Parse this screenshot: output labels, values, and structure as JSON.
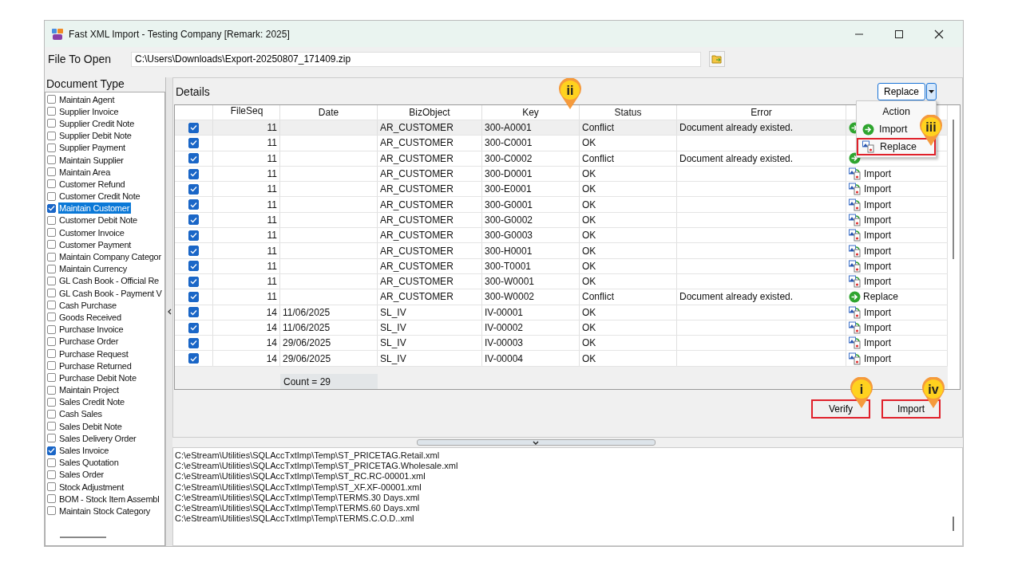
{
  "window": {
    "title": "Fast XML Import - Testing Company [Remark: 2025]"
  },
  "file_to_open": {
    "label": "File To Open",
    "value": "C:\\Users\\Downloads\\Export-20250807_171409.zip"
  },
  "document_type": {
    "title": "Document Type",
    "items": [
      {
        "label": "Maintain Agent",
        "checked": false,
        "selected": false
      },
      {
        "label": "Supplier Invoice",
        "checked": false,
        "selected": false
      },
      {
        "label": "Supplier Credit Note",
        "checked": false,
        "selected": false
      },
      {
        "label": "Supplier Debit Note",
        "checked": false,
        "selected": false
      },
      {
        "label": "Supplier Payment",
        "checked": false,
        "selected": false
      },
      {
        "label": "Maintain Supplier",
        "checked": false,
        "selected": false
      },
      {
        "label": "Maintain Area",
        "checked": false,
        "selected": false
      },
      {
        "label": "Customer Refund",
        "checked": false,
        "selected": false
      },
      {
        "label": "Customer Credit Note",
        "checked": false,
        "selected": false
      },
      {
        "label": "Maintain Customer",
        "checked": true,
        "selected": true
      },
      {
        "label": "Customer Debit Note",
        "checked": false,
        "selected": false
      },
      {
        "label": "Customer Invoice",
        "checked": false,
        "selected": false
      },
      {
        "label": "Customer Payment",
        "checked": false,
        "selected": false
      },
      {
        "label": "Maintain Company Categor",
        "checked": false,
        "selected": false
      },
      {
        "label": "Maintain Currency",
        "checked": false,
        "selected": false
      },
      {
        "label": "GL Cash Book - Official Re",
        "checked": false,
        "selected": false
      },
      {
        "label": "GL Cash Book - Payment V",
        "checked": false,
        "selected": false
      },
      {
        "label": "Cash Purchase",
        "checked": false,
        "selected": false
      },
      {
        "label": "Goods Received",
        "checked": false,
        "selected": false
      },
      {
        "label": "Purchase Invoice",
        "checked": false,
        "selected": false
      },
      {
        "label": "Purchase Order",
        "checked": false,
        "selected": false
      },
      {
        "label": "Purchase Request",
        "checked": false,
        "selected": false
      },
      {
        "label": "Purchase Returned",
        "checked": false,
        "selected": false
      },
      {
        "label": "Purchase Debit Note",
        "checked": false,
        "selected": false
      },
      {
        "label": "Maintain Project",
        "checked": false,
        "selected": false
      },
      {
        "label": "Sales Credit Note",
        "checked": false,
        "selected": false
      },
      {
        "label": "Cash Sales",
        "checked": false,
        "selected": false
      },
      {
        "label": "Sales Debit Note",
        "checked": false,
        "selected": false
      },
      {
        "label": "Sales Delivery Order",
        "checked": false,
        "selected": false
      },
      {
        "label": "Sales Invoice",
        "checked": true,
        "selected": false
      },
      {
        "label": "Sales Quotation",
        "checked": false,
        "selected": false
      },
      {
        "label": "Sales Order",
        "checked": false,
        "selected": false
      },
      {
        "label": "Stock Adjustment",
        "checked": false,
        "selected": false
      },
      {
        "label": "BOM - Stock Item Assembl",
        "checked": false,
        "selected": false
      },
      {
        "label": "Maintain Stock Category",
        "checked": false,
        "selected": false
      }
    ]
  },
  "details": {
    "title": "Details",
    "action_button": {
      "label": "Replace"
    },
    "menu": {
      "header": "Action",
      "items": [
        {
          "label": "Import",
          "kind": "arrow",
          "highlighted": false
        },
        {
          "label": "Replace",
          "kind": "image",
          "highlighted": true
        }
      ]
    },
    "table": {
      "columns": [
        "FileSeq",
        "Date",
        "BizObject",
        "Key",
        "Status",
        "Error"
      ],
      "rows": [
        {
          "selected": true,
          "checked": true,
          "fileseq": "11",
          "bizobject": "AR_CUSTOMER",
          "key": "300-A0001",
          "status": "Conflict",
          "error": "Document already existed.",
          "action": {
            "kind": "arrow"
          }
        },
        {
          "selected": false,
          "checked": true,
          "fileseq": "11",
          "bizobject": "AR_CUSTOMER",
          "key": "300-C0001",
          "status": "OK"
        },
        {
          "selected": false,
          "checked": true,
          "fileseq": "11",
          "bizobject": "AR_CUSTOMER",
          "key": "300-C0002",
          "status": "Conflict",
          "error": "Document already existed.",
          "action": {
            "kind": "arrow"
          }
        },
        {
          "selected": false,
          "checked": true,
          "fileseq": "11",
          "bizobject": "AR_CUSTOMER",
          "key": "300-D0001",
          "status": "OK",
          "action": {
            "kind": "image",
            "label": "Import"
          }
        },
        {
          "selected": false,
          "checked": true,
          "fileseq": "11",
          "bizobject": "AR_CUSTOMER",
          "key": "300-E0001",
          "status": "OK",
          "action": {
            "kind": "image",
            "label": "Import"
          }
        },
        {
          "selected": false,
          "checked": true,
          "fileseq": "11",
          "bizobject": "AR_CUSTOMER",
          "key": "300-G0001",
          "status": "OK",
          "action": {
            "kind": "image",
            "label": "Import"
          }
        },
        {
          "selected": false,
          "checked": true,
          "fileseq": "11",
          "bizobject": "AR_CUSTOMER",
          "key": "300-G0002",
          "status": "OK",
          "action": {
            "kind": "image",
            "label": "Import"
          }
        },
        {
          "selected": false,
          "checked": true,
          "fileseq": "11",
          "bizobject": "AR_CUSTOMER",
          "key": "300-G0003",
          "status": "OK",
          "action": {
            "kind": "image",
            "label": "Import"
          }
        },
        {
          "selected": false,
          "checked": true,
          "fileseq": "11",
          "bizobject": "AR_CUSTOMER",
          "key": "300-H0001",
          "status": "OK",
          "action": {
            "kind": "image",
            "label": "Import"
          }
        },
        {
          "selected": false,
          "checked": true,
          "fileseq": "11",
          "bizobject": "AR_CUSTOMER",
          "key": "300-T0001",
          "status": "OK",
          "action": {
            "kind": "image",
            "label": "Import"
          }
        },
        {
          "selected": false,
          "checked": true,
          "fileseq": "11",
          "bizobject": "AR_CUSTOMER",
          "key": "300-W0001",
          "status": "OK",
          "action": {
            "kind": "image",
            "label": "Import"
          }
        },
        {
          "selected": false,
          "checked": true,
          "fileseq": "11",
          "bizobject": "AR_CUSTOMER",
          "key": "300-W0002",
          "status": "Conflict",
          "error": "Document already existed.",
          "action": {
            "kind": "arrow",
            "label": "Replace"
          }
        },
        {
          "selected": false,
          "checked": true,
          "fileseq": "14",
          "date": "11/06/2025",
          "bizobject": "SL_IV",
          "key": "IV-00001",
          "status": "OK",
          "action": {
            "kind": "image",
            "label": "Import"
          }
        },
        {
          "selected": false,
          "checked": true,
          "fileseq": "14",
          "date": "11/06/2025",
          "bizobject": "SL_IV",
          "key": "IV-00002",
          "status": "OK",
          "action": {
            "kind": "image",
            "label": "Import"
          }
        },
        {
          "selected": false,
          "checked": true,
          "fileseq": "14",
          "date": "29/06/2025",
          "bizobject": "SL_IV",
          "key": "IV-00003",
          "status": "OK",
          "action": {
            "kind": "image",
            "label": "Import"
          }
        },
        {
          "selected": false,
          "checked": true,
          "fileseq": "14",
          "date": "29/06/2025",
          "bizobject": "SL_IV",
          "key": "IV-00004",
          "status": "OK",
          "action": {
            "kind": "image",
            "label": "Import"
          }
        }
      ],
      "footer": "Count = 29"
    },
    "buttons": [
      {
        "label": "Verify",
        "highlighted": true
      },
      {
        "label": "Import",
        "highlighted": true
      }
    ]
  },
  "log_lines": [
    "C:\\eStream\\Utilities\\SQLAccTxtImp\\Temp\\ST_PRICETAG.Retail.xml",
    "C:\\eStream\\Utilities\\SQLAccTxtImp\\Temp\\ST_PRICETAG.Wholesale.xml",
    "C:\\eStream\\Utilities\\SQLAccTxtImp\\Temp\\ST_RC.RC-00001.xml",
    "C:\\eStream\\Utilities\\SQLAccTxtImp\\Temp\\ST_XF.XF-00001.xml",
    "C:\\eStream\\Utilities\\SQLAccTxtImp\\Temp\\TERMS.30 Days.xml",
    "C:\\eStream\\Utilities\\SQLAccTxtImp\\Temp\\TERMS.60 Days.xml",
    "C:\\eStream\\Utilities\\SQLAccTxtImp\\Temp\\TERMS.C.O.D..xml"
  ],
  "callouts": [
    {
      "label": "ii"
    },
    {
      "label": "iii"
    },
    {
      "label": "i"
    },
    {
      "label": "iv"
    }
  ]
}
